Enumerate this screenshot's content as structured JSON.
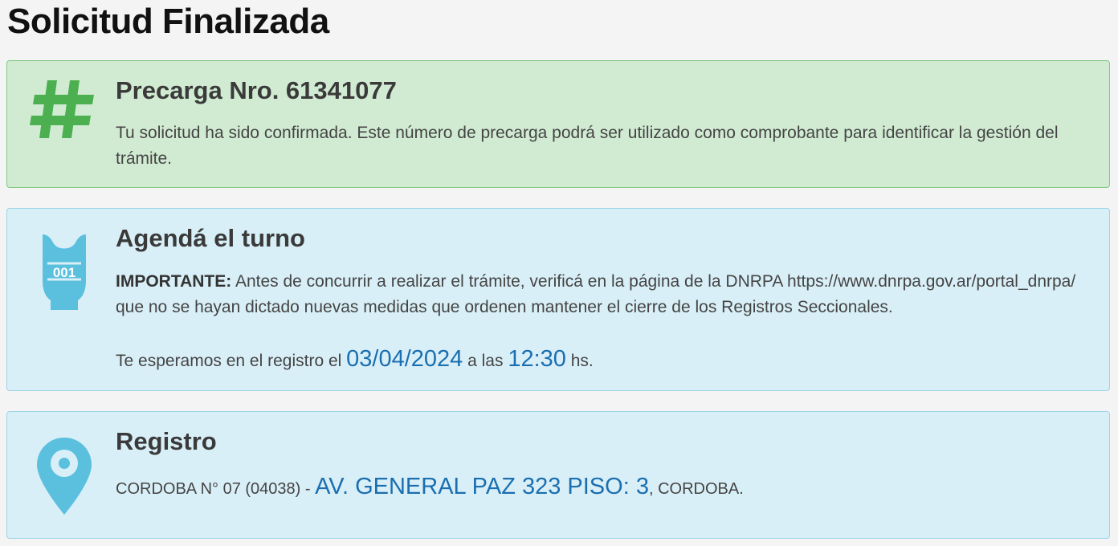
{
  "page": {
    "title": "Solicitud Finalizada"
  },
  "precarga": {
    "title": "Precarga Nro. 61341077",
    "text": "Tu solicitud ha sido confirmada. Este número de precarga podrá ser utilizado como comprobante para identificar la gestión del trámite.",
    "icon": "hash-icon",
    "color": "#4caf50"
  },
  "turno": {
    "title": "Agendá el turno",
    "important_label": "IMPORTANTE:",
    "important_text": " Antes de concurrir a realizar el trámite, verificá en la página de la DNRPA https://www.dnrpa.gov.ar/portal_dnrpa/ que no se hayan dictado nuevas medidas que ordenen mantener el cierre de los Registros Seccionales.",
    "wait_prefix": "Te esperamos en el registro el ",
    "date": "03/04/2024",
    "time_prefix": " a las ",
    "time": "12:30",
    "time_suffix": " hs.",
    "icon": "ticket-icon",
    "ticket_number": "001",
    "color": "#5bc0de"
  },
  "registro": {
    "title": "Registro",
    "prefix": "CORDOBA N° 07 (04038) - ",
    "address": "AV. GENERAL PAZ 323 PISO: 3",
    "suffix": ", CORDOBA.",
    "icon": "location-pin-icon",
    "color": "#5bc0de"
  }
}
